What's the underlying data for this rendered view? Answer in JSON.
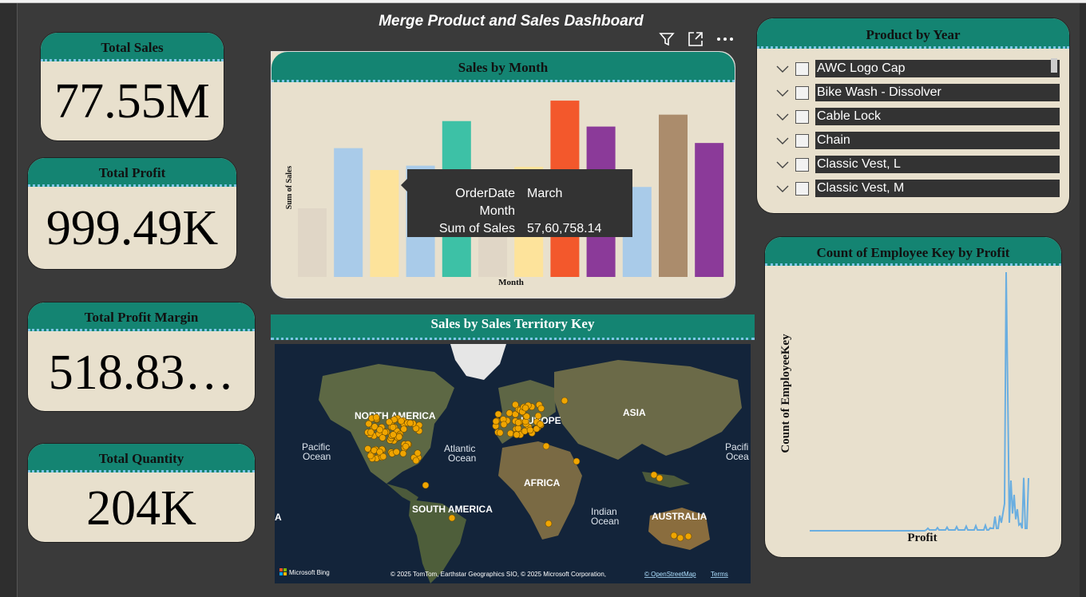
{
  "dashboard": {
    "title": "Merge Product and Sales Dashboard"
  },
  "kpis": [
    {
      "title": "Total Sales",
      "value": "77.55M"
    },
    {
      "title": "Total Profit",
      "value": "999.49K"
    },
    {
      "title": "Total Profit Margin",
      "value": "518.83…"
    },
    {
      "title": "Total Quantity",
      "value": "204K"
    }
  ],
  "visual_icons": [
    "filter-icon",
    "focus-mode-icon",
    "more-options-icon"
  ],
  "chart_data": [
    {
      "type": "bar",
      "title": "Sales by Month",
      "xlabel": "Month",
      "ylabel": "Sum of Sales",
      "values": [
        4.26,
        8.0,
        6.64,
        6.91,
        9.68,
        5.76,
        6.84,
        10.95,
        9.34,
        5.59,
        10.08,
        8.32
      ],
      "colors": [
        "#e0d6c6",
        "#a9cbe9",
        "#fde39b",
        "#a9cbe9",
        "#3dc1a6",
        "#e0d6c6",
        "#fde39b",
        "#f3582c",
        "#8b3a99",
        "#a9cbe9",
        "#ab8c6c",
        "#8b3a99"
      ],
      "ylim": [
        0,
        11.5
      ],
      "tooltip": {
        "rows": [
          {
            "key": "OrderDate Month",
            "value": "March"
          },
          {
            "key": "Sum of Sales",
            "value": "57,60,758.14"
          }
        ]
      }
    },
    {
      "type": "line",
      "title": "Count of Employee Key by Profit",
      "xlabel": "Profit",
      "ylabel": "Count of EmployeeKey",
      "color": "#6aaee0"
    }
  ],
  "map": {
    "title": "Sales by Sales Territory Key",
    "labels": {
      "north_america": "NORTH AMERICA",
      "europe": "EUROPE",
      "asia": "ASIA",
      "africa": "AFRICA",
      "south_america": "SOUTH AMERICA",
      "australia": "AUSTRALIA",
      "pacific_1": "Pacific",
      "pacific_2": "Ocean",
      "atlantic_1": "Atlantic",
      "atlantic_2": "Ocean",
      "indian_1": "Indian",
      "indian_2": "Ocean",
      "pacific_r1": "Pacifi",
      "pacific_r2": "Ocea",
      "left_a": "A"
    },
    "brand": "Microsoft Bing",
    "attribution": "© 2025 TomTom, Earthstar Geographics SIO, © 2025 Microsoft Corporation,",
    "osm": "© OpenStreetMap",
    "terms": "Terms"
  },
  "slicer": {
    "title": "Product by Year",
    "items": [
      "AWC Logo Cap",
      "Bike Wash - Dissolver",
      "Cable Lock",
      "Chain",
      "Classic Vest, L",
      "Classic Vest, M"
    ]
  },
  "colors": {
    "header_teal": "#148472",
    "card_bg": "#e8e0cd",
    "dots": "#f0a500"
  }
}
